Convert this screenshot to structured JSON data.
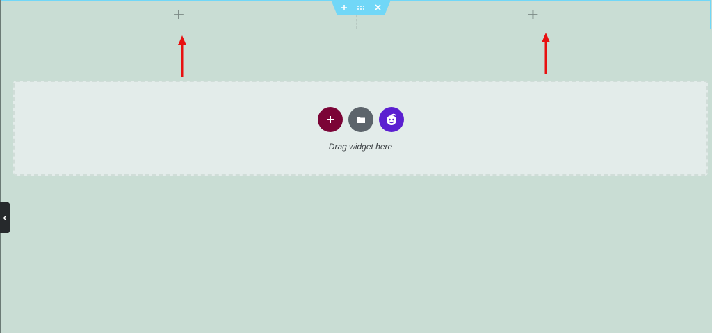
{
  "section": {
    "handle": {
      "add_icon": "plus-icon",
      "drag_icon": "drag-handle-icon",
      "delete_icon": "close-icon"
    },
    "columns": [
      {
        "add_label": "+"
      },
      {
        "add_label": "+"
      }
    ],
    "accent_color": "#71d7f7"
  },
  "annotations": {
    "arrow_color": "#e81010",
    "count": 2
  },
  "dropzone": {
    "buttons": [
      {
        "icon": "plus-icon",
        "color": "#7b0436"
      },
      {
        "icon": "folder-icon",
        "color": "#5c646b"
      },
      {
        "icon": "addon-logo-icon",
        "color": "#5b1fd0"
      }
    ],
    "label": "Drag widget here"
  },
  "panel_toggle": {
    "icon": "chevron-left-icon"
  },
  "background_color": "#c9ddd4"
}
